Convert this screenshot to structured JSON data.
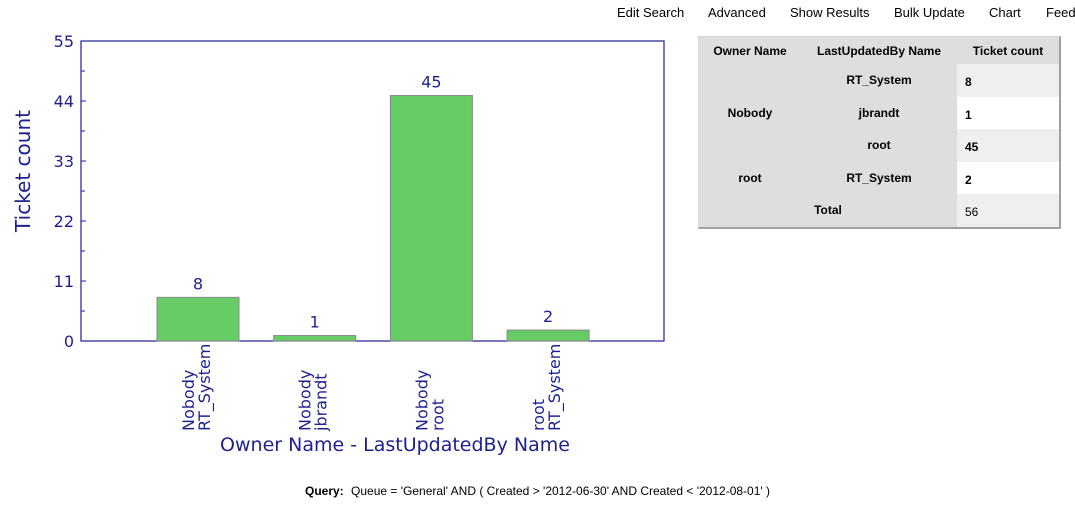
{
  "nav": {
    "items": [
      {
        "label": "Edit Search"
      },
      {
        "label": "Advanced"
      },
      {
        "label": "Show Results"
      },
      {
        "label": "Bulk Update"
      },
      {
        "label": "Chart"
      },
      {
        "label": "Feed"
      }
    ]
  },
  "colors": {
    "axis": "#1f1f8f",
    "bar_fill": "#66cc66",
    "bar_stroke": "#888888",
    "table_bg": "#dedede"
  },
  "chart_data": {
    "type": "bar",
    "title": "",
    "xlabel": "Owner Name - LastUpdatedBy Name",
    "ylabel": "Ticket count",
    "ylim": [
      0,
      55
    ],
    "yticks": [
      0,
      11,
      22,
      33,
      44,
      55
    ],
    "grid": false,
    "categories": [
      [
        "Nobody",
        "RT_System"
      ],
      [
        "Nobody",
        "jbrandt"
      ],
      [
        "Nobody",
        "root"
      ],
      [
        "root",
        "RT_System"
      ]
    ],
    "values": [
      8,
      1,
      45,
      2
    ],
    "data_labels": [
      "8",
      "1",
      "45",
      "2"
    ]
  },
  "table": {
    "headers": [
      "Owner Name",
      "LastUpdatedBy Name",
      "Ticket count"
    ],
    "groups": [
      {
        "owner": "Nobody",
        "rows": [
          {
            "updated_by": "RT_System",
            "count": "8"
          },
          {
            "updated_by": "jbrandt",
            "count": "1"
          },
          {
            "updated_by": "root",
            "count": "45"
          }
        ]
      },
      {
        "owner": "root",
        "rows": [
          {
            "updated_by": "RT_System",
            "count": "2"
          }
        ]
      }
    ],
    "total_label": "Total",
    "total_value": "56"
  },
  "query": {
    "label": "Query:",
    "text": "Queue = 'General' AND ( Created > '2012-06-30' AND Created < '2012-08-01' )"
  }
}
